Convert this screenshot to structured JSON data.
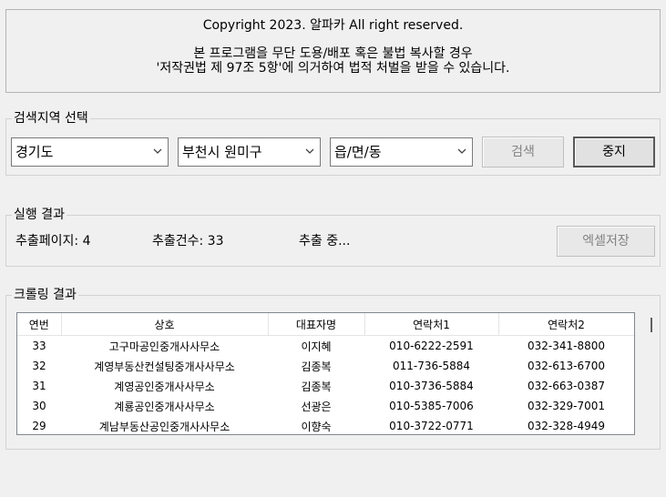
{
  "copyright": {
    "line1": "Copyright 2023. 알파카 All right reserved.",
    "line2": "본 프로그램을 무단 도용/배포 혹은 불법 복사할 경우",
    "line3": "'저작권법 제 97조 5항'에 의거하여 법적 처벌을 받을 수 있습니다."
  },
  "search": {
    "title": "검색지역 선택",
    "province": "경기도",
    "city": "부천시 원미구",
    "town": "읍/면/동",
    "search_label": "검색",
    "stop_label": "중지"
  },
  "result": {
    "title": "실행 결과",
    "pages": "추출페이지: 4",
    "count": "추출건수: 33",
    "status": "추출 중...",
    "excel_label": "엑셀저장"
  },
  "crawl": {
    "title": "크롤링 결과",
    "columns": [
      "연번",
      "상호",
      "대표자명",
      "연락처1",
      "연락처2"
    ],
    "rows": [
      [
        "33",
        "고구마공인중개사사무소",
        "이지혜",
        "010-6222-2591",
        "032-341-8800"
      ],
      [
        "32",
        "계영부동산컨설팅중개사사무소",
        "김종복",
        "011-736-5884",
        "032-613-6700"
      ],
      [
        "31",
        "계영공인중개사사무소",
        "김종복",
        "010-3736-5884",
        "032-663-0387"
      ],
      [
        "30",
        "계룡공인중개사사무소",
        "선광은",
        "010-5385-7006",
        "032-329-7001"
      ],
      [
        "29",
        "계남부동산공인중개사사무소",
        "이향숙",
        "010-3722-0771",
        "032-328-4949"
      ]
    ]
  }
}
